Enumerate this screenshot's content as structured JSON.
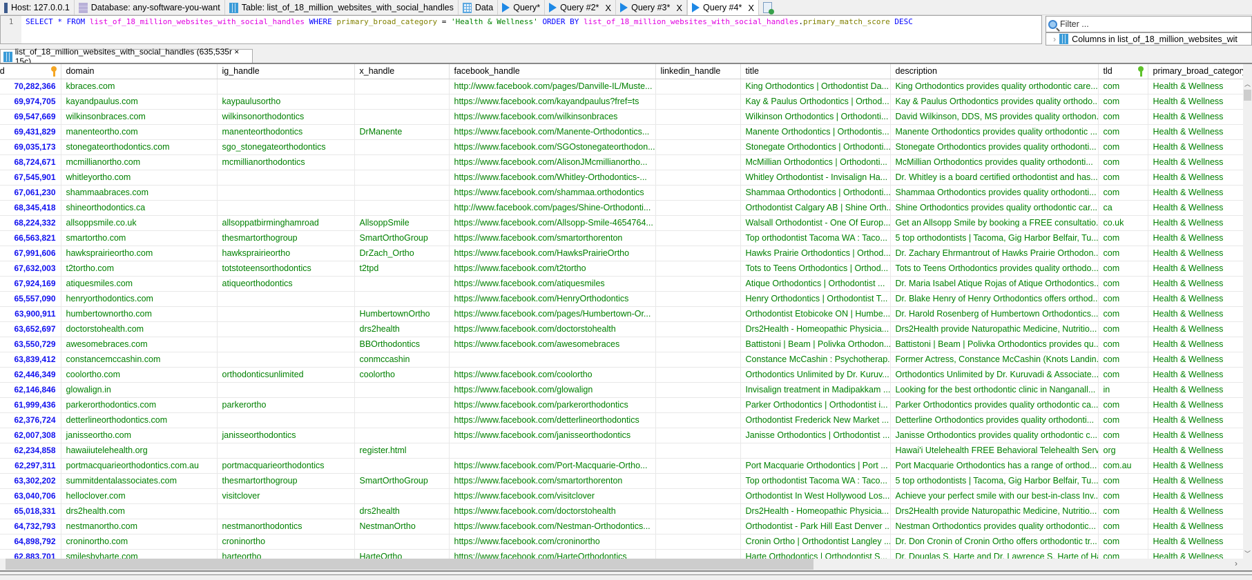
{
  "tabs": [
    {
      "label": "Host: 127.0.0.1",
      "icon": "host-icon"
    },
    {
      "label": "Database: any-software-you-want",
      "icon": "database-icon"
    },
    {
      "label": "Table: list_of_18_million_websites_with_social_handles",
      "icon": "table-icon"
    },
    {
      "label": "Data",
      "icon": "data-grid-icon"
    },
    {
      "label": "Query*",
      "icon": "query-play-icon"
    },
    {
      "label": "Query #2*",
      "icon": "query-play-icon",
      "close": "X"
    },
    {
      "label": "Query #3*",
      "icon": "query-play-icon",
      "close": "X"
    },
    {
      "label": "Query #4*",
      "icon": "query-play-icon",
      "close": "X",
      "active": true
    }
  ],
  "editor": {
    "line_number": "1",
    "sql_tokens": [
      {
        "t": "SELECT",
        "c": "kw"
      },
      {
        "t": " * ",
        "c": "kw"
      },
      {
        "t": "FROM",
        "c": "kw"
      },
      {
        "t": " ",
        "c": "op"
      },
      {
        "t": "list_of_18_million_websites_with_social_handles",
        "c": "tb"
      },
      {
        "t": " ",
        "c": "op"
      },
      {
        "t": "WHERE",
        "c": "kw"
      },
      {
        "t": " ",
        "c": "op"
      },
      {
        "t": "primary_broad_category",
        "c": "col"
      },
      {
        "t": " = ",
        "c": "op"
      },
      {
        "t": "'Health & Wellness'",
        "c": "str"
      },
      {
        "t": " ",
        "c": "op"
      },
      {
        "t": "ORDER BY",
        "c": "kw"
      },
      {
        "t": " ",
        "c": "op"
      },
      {
        "t": "list_of_18_million_websites_with_social_handles",
        "c": "tb"
      },
      {
        "t": ".",
        "c": "op"
      },
      {
        "t": "primary_match_score",
        "c": "col"
      },
      {
        "t": " ",
        "c": "op"
      },
      {
        "t": "DESC",
        "c": "kw"
      }
    ]
  },
  "side": {
    "filter_placeholder": "Filter ...",
    "columns_node": "Columns in list_of_18_million_websites_wit"
  },
  "result_tab": {
    "label": "list_of_18_million_websites_with_social_handles (635,535r × 15c)"
  },
  "grid": {
    "columns": [
      "id",
      "domain",
      "ig_handle",
      "x_handle",
      "facebook_handle",
      "linkedin_handle",
      "title",
      "description",
      "tld",
      "primary_broad_category"
    ],
    "rows": [
      [
        "70,282,366",
        "kbraces.com",
        "",
        "",
        "http://www.facebook.com/pages/Danville-IL/Muste...",
        "",
        "King Orthodontics | Orthodontist Da...",
        "King Orthodontics provides quality orthodontic care...",
        "com",
        "Health & Wellness"
      ],
      [
        "69,974,705",
        "kayandpaulus.com",
        "kaypaulusortho",
        "",
        "https://www.facebook.com/kayandpaulus?fref=ts",
        "",
        "Kay & Paulus Orthodontics | Orthod...",
        "Kay & Paulus Orthodontics provides quality orthodo...",
        "com",
        "Health & Wellness"
      ],
      [
        "69,547,669",
        "wilkinsonbraces.com",
        "wilkinsonorthodontics",
        "",
        "https://www.facebook.com/wilkinsonbraces",
        "",
        "Wilkinson Orthodontics | Orthodonti...",
        "David Wilkinson, DDS, MS provides quality orthodon...",
        "com",
        "Health & Wellness"
      ],
      [
        "69,431,829",
        "manenteortho.com",
        "manenteorthodontics",
        "DrManente",
        "https://www.facebook.com/Manente-Orthodontics...",
        "",
        "Manente Orthodontics | Orthodontis...",
        "Manente Orthodontics provides quality orthodontic ...",
        "com",
        "Health & Wellness"
      ],
      [
        "69,035,173",
        "stonegateorthodontics.com",
        "sgo_stonegateorthodontics",
        "",
        "https://www.facebook.com/SGOstonegateorthodon...",
        "",
        "Stonegate Orthodontics | Orthodonti...",
        "Stonegate Orthodontics provides quality orthodonti...",
        "com",
        "Health & Wellness"
      ],
      [
        "68,724,671",
        "mcmillianortho.com",
        "mcmillianorthodontics",
        "",
        "https://www.facebook.com/AlisonJMcmillianortho...",
        "",
        "McMillian Orthodontics | Orthodonti...",
        "McMillian Orthodontics provides quality orthodonti...",
        "com",
        "Health & Wellness"
      ],
      [
        "67,545,901",
        "whitleyortho.com",
        "",
        "",
        "https://www.facebook.com/Whitley-Orthodontics-...",
        "",
        "Whitley Orthodontist - Invisalign Ha...",
        "Dr.  Whitley is a board certified orthodontist and has...",
        "com",
        "Health & Wellness"
      ],
      [
        "67,061,230",
        "shammaabraces.com",
        "",
        "",
        "https://www.facebook.com/shammaa.orthodontics",
        "",
        "Shammaa Orthodontics | Orthodonti...",
        "Shammaa Orthodontics provides quality orthodonti...",
        "com",
        "Health & Wellness"
      ],
      [
        "68,345,418",
        "shineorthodontics.ca",
        "",
        "",
        "http://www.facebook.com/pages/Shine-Orthodonti...",
        "",
        "Orthodontist Calgary AB | Shine Orth...",
        "Shine Orthodontics provides quality orthodontic car...",
        "ca",
        "Health & Wellness"
      ],
      [
        "68,224,332",
        "allsoppsmile.co.uk",
        "allsoppatbirminghamroad",
        "AllsoppSmile",
        "https://www.facebook.com/Allsopp-Smile-4654764...",
        "",
        "Walsall Orthodontist - One Of Europ...",
        "Get an Allsopp Smile by booking a FREE consultatio...",
        "co.uk",
        "Health & Wellness"
      ],
      [
        "66,563,821",
        "smartortho.com",
        "thesmartorthogroup",
        "SmartOrthoGroup",
        "https://www.facebook.com/smartorthorenton",
        "",
        "Top orthodontist Tacoma WA : Taco...",
        "5 top orthodontists | Tacoma, Gig Harbor Belfair, Tu...",
        "com",
        "Health & Wellness"
      ],
      [
        "67,991,606",
        "hawksprairieortho.com",
        "hawksprairieortho",
        "DrZach_Ortho",
        "https://www.facebook.com/HawksPrairieOrtho",
        "",
        "Hawks Prairie Orthodontics | Orthod...",
        "Dr. Zachary Ehrmantrout of Hawks Prairie Orthodon...",
        "com",
        "Health & Wellness"
      ],
      [
        "67,632,003",
        "t2tortho.com",
        "totstoteensorthodontics",
        "t2tpd",
        "https://www.facebook.com/t2tortho",
        "",
        "Tots to Teens Orthodontics | Orthod...",
        "Tots to Teens Orthodontics provides quality orthodo...",
        "com",
        "Health & Wellness"
      ],
      [
        "67,924,169",
        "atiquesmiles.com",
        "atiqueorthodontics",
        "",
        "https://www.facebook.com/atiquesmiles",
        "",
        "Atique Orthodontics | Orthodontist ...",
        "Dr. Maria Isabel Atique Rojas of Atique Orthodontics...",
        "com",
        "Health & Wellness"
      ],
      [
        "65,557,090",
        "henryorthodontics.com",
        "",
        "",
        "https://www.facebook.com/HenryOrthodontics",
        "",
        "Henry Orthodontics | Orthodontist T...",
        "Dr. Blake Henry of Henry Orthodontics offers orthod...",
        "com",
        "Health & Wellness"
      ],
      [
        "63,900,911",
        "humbertownortho.com",
        "",
        "HumbertownOrtho",
        "https://www.facebook.com/pages/Humbertown-Or...",
        "",
        "Orthodontist Etobicoke ON | Humbe...",
        "Dr. Harold Rosenberg of Humbertown Orthodontics...",
        "com",
        "Health & Wellness"
      ],
      [
        "63,652,697",
        "doctorstohealth.com",
        "",
        "drs2health",
        "https://www.facebook.com/doctorstohealth",
        "",
        "Drs2Health - Homeopathic Physicia...",
        "Drs2Health provide Naturopathic Medicine, Nutritio...",
        "com",
        "Health & Wellness"
      ],
      [
        "63,550,729",
        "awesomebraces.com",
        "",
        "BBOrthodontics",
        "https://www.facebook.com/awesomebraces",
        "",
        "Battistoni | Beam | Polivka Orthodon...",
        "Battistoni | Beam | Polivka Orthodontics provides qu...",
        "com",
        "Health & Wellness"
      ],
      [
        "63,839,412",
        "constancemccashin.com",
        "",
        "conmccashin",
        "",
        "",
        "Constance McCashin : Psychotherap...",
        "Former Actress, Constance McCashin (Knots Landin...",
        "com",
        "Health & Wellness"
      ],
      [
        "62,446,349",
        "coolortho.com",
        "orthodonticsunlimited",
        "coolortho",
        "https://www.facebook.com/coolortho",
        "",
        "Orthodontics Unlimited by Dr. Kuruv...",
        "Orthodontics Unlimited by Dr. Kuruvadi & Associate...",
        "com",
        "Health & Wellness"
      ],
      [
        "62,146,846",
        "glowalign.in",
        "",
        "",
        "https://www.facebook.com/glowalign",
        "",
        "Invisalign treatment in Madipakkam ...",
        "Looking for the best orthodontic clinic in Nanganall...",
        "in",
        "Health & Wellness"
      ],
      [
        "61,999,436",
        "parkerorthodontics.com",
        "parkerortho",
        "",
        "https://www.facebook.com/parkerorthodontics",
        "",
        "Parker Orthodontics | Orthodontist i...",
        "Parker Orthodontics provides quality orthodontic ca...",
        "com",
        "Health & Wellness"
      ],
      [
        "62,376,724",
        "detterlineorthodontics.com",
        "",
        "",
        "https://www.facebook.com/detterlineorthodontics",
        "",
        "Orthodontist Frederick New Market ...",
        "Detterline Orthodontics provides quality orthodonti...",
        "com",
        "Health & Wellness"
      ],
      [
        "62,007,308",
        "janisseortho.com",
        "janisseorthodontics",
        "",
        "https://www.facebook.com/janisseorthodontics",
        "",
        "Janisse Orthodontics | Orthodontist ...",
        "Janisse Orthodontics provides quality orthodontic c...",
        "com",
        "Health & Wellness"
      ],
      [
        "62,234,858",
        "hawaiiutelehealth.org",
        "",
        "register.html",
        "",
        "",
        "",
        "Hawai'i Utelehealth FREE Behavioral Telehealth Servi...",
        "org",
        "Health & Wellness"
      ],
      [
        "62,297,311",
        "portmacquarieorthodontics.com.au",
        "portmacquarieorthodontics",
        "",
        "https://www.facebook.com/Port-Macquarie-Ortho...",
        "",
        "Port Macquarie Orthodontics | Port ...",
        "Port Macquarie Orthodontics has a range of orthod...",
        "com.au",
        "Health & Wellness"
      ],
      [
        "63,302,202",
        "summitdentalassociates.com",
        "thesmartorthogroup",
        "SmartOrthoGroup",
        "https://www.facebook.com/smartorthorenton",
        "",
        "Top orthodontist Tacoma WA : Taco...",
        "5 top orthodontists | Tacoma, Gig Harbor Belfair, Tu...",
        "com",
        "Health & Wellness"
      ],
      [
        "63,040,706",
        "helloclover.com",
        "visitclover",
        "",
        "https://www.facebook.com/visitclover",
        "",
        "Orthodontist In West Hollywood Los...",
        "Achieve your perfect smile with our best-in-class Inv...",
        "com",
        "Health & Wellness"
      ],
      [
        "65,018,331",
        "drs2health.com",
        "",
        "drs2health",
        "https://www.facebook.com/doctorstohealth",
        "",
        "Drs2Health - Homeopathic Physicia...",
        "Drs2Health provide Naturopathic Medicine, Nutritio...",
        "com",
        "Health & Wellness"
      ],
      [
        "64,732,793",
        "nestmanortho.com",
        "nestmanorthodontics",
        "NestmanOrtho",
        "https://www.facebook.com/Nestman-Orthodontics...",
        "",
        "Orthodontist - Park Hill East Denver ...",
        "Nestman Orthodontics provides quality orthodontic...",
        "com",
        "Health & Wellness"
      ],
      [
        "64,898,792",
        "croninortho.com",
        "croninortho",
        "",
        "https://www.facebook.com/croninortho",
        "",
        "Cronin Ortho | Orthodontist Langley ...",
        "Dr. Don Cronin of Cronin Ortho offers orthodontic tr...",
        "com",
        "Health & Wellness"
      ],
      [
        "62,883,701",
        "smilesbyharte.com",
        "harteortho",
        "HarteOrtho",
        "https://www.facebook.com/HarteOrthodontics",
        "",
        "Harte Orthodontics | Orthodontist S...",
        "Dr. Douglas S. Harte and Dr. Lawrence S. Harte of Ha...",
        "com",
        "Health & Wellness"
      ]
    ]
  },
  "colors": {
    "id_text": "#1010f0",
    "cell_text": "#008000",
    "primary_key": "#f5a623",
    "unique_key": "#5ec22a"
  }
}
